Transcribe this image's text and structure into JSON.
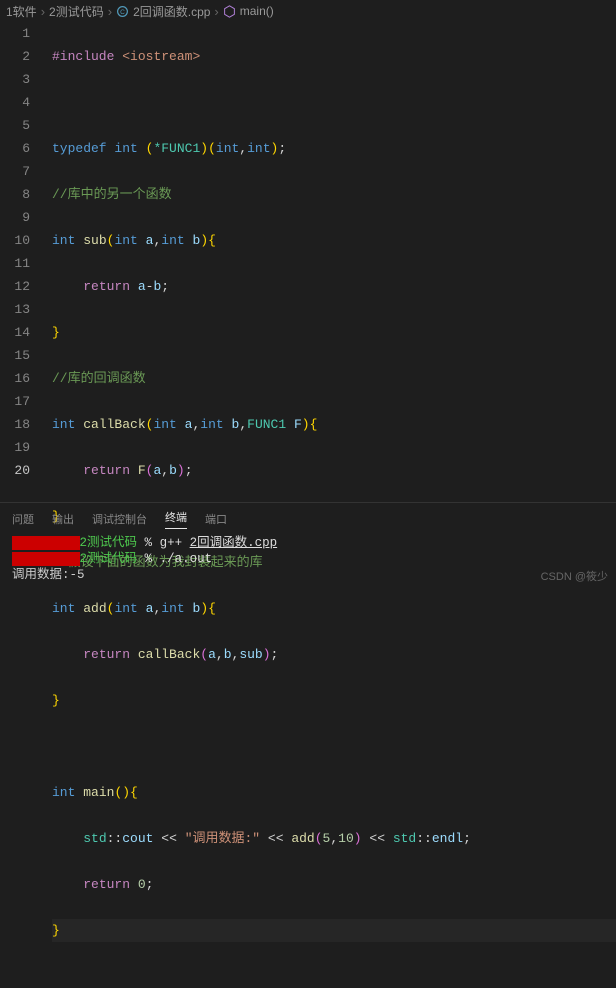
{
  "breadcrumb": {
    "items": [
      {
        "label": "1软件"
      },
      {
        "label": "2测试代码"
      },
      {
        "label": "2回调函数.cpp"
      },
      {
        "label": "main()"
      }
    ]
  },
  "editor": {
    "lines": [
      {
        "n": "1"
      },
      {
        "n": "2"
      },
      {
        "n": "3"
      },
      {
        "n": "4"
      },
      {
        "n": "5"
      },
      {
        "n": "6"
      },
      {
        "n": "7"
      },
      {
        "n": "8"
      },
      {
        "n": "9"
      },
      {
        "n": "10"
      },
      {
        "n": "11"
      },
      {
        "n": "12"
      },
      {
        "n": "13"
      },
      {
        "n": "14"
      },
      {
        "n": "15"
      },
      {
        "n": "16"
      },
      {
        "n": "17"
      },
      {
        "n": "18"
      },
      {
        "n": "19"
      },
      {
        "n": "20"
      }
    ],
    "code": {
      "l1_include": "#include",
      "l1_header": "<iostream>",
      "l3_typedef": "typedef",
      "l3_int": "int",
      "l3_funcptr": "*FUNC1",
      "l3_int2": "int",
      "l3_int3": "int",
      "l4_comment": "//库中的另一个函数",
      "l5_int": "int",
      "l5_func": "sub",
      "l5_int_a": "int",
      "l5_a": "a",
      "l5_int_b": "int",
      "l5_b": "b",
      "l6_return": "return",
      "l6_a": "a",
      "l6_op": "-",
      "l6_b": "b",
      "l8_comment": "//库的回调函数",
      "l9_int": "int",
      "l9_func": "callBack",
      "l9_int_a": "int",
      "l9_a": "a",
      "l9_int_b": "int",
      "l9_b": "b",
      "l9_type": "FUNC1",
      "l9_F": "F",
      "l10_return": "return",
      "l10_F": "F",
      "l10_a": "a",
      "l10_b": "b",
      "l12_comment": "//假设下面的函数为我封装起来的库",
      "l13_int": "int",
      "l13_func": "add",
      "l13_int_a": "int",
      "l13_a": "a",
      "l13_int_b": "int",
      "l13_b": "b",
      "l14_return": "return",
      "l14_call": "callBack",
      "l14_a": "a",
      "l14_b": "b",
      "l14_sub": "sub",
      "l17_int": "int",
      "l17_main": "main",
      "l18_std1": "std",
      "l18_cout": "cout",
      "l18_str": "\"调用数据:\"",
      "l18_add": "add",
      "l18_n1": "5",
      "l18_n2": "10",
      "l18_std2": "std",
      "l18_endl": "endl",
      "l19_return": "return",
      "l19_zero": "0"
    }
  },
  "panel": {
    "tabs": {
      "problems": "问题",
      "output": "输出",
      "debug": "调试控制台",
      "terminal": "终端",
      "ports": "端口"
    },
    "terminal": {
      "dir": "2测试代码",
      "prompt": "%",
      "cmd1_gpp": "g++",
      "cmd1_file": "2回调函数.cpp",
      "cmd2": "./a.out",
      "output": "调用数据:-5"
    }
  },
  "watermark": "CSDN @筱少"
}
